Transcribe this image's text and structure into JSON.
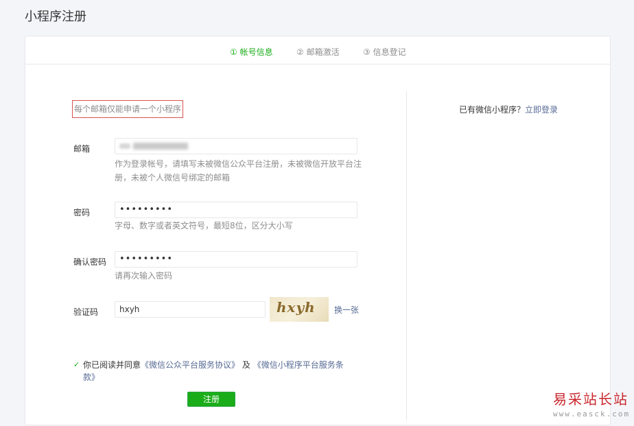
{
  "page": {
    "title": "小程序注册"
  },
  "steps": [
    {
      "label": "① 帐号信息",
      "active": true
    },
    {
      "label": "② 邮箱激活",
      "active": false
    },
    {
      "label": "③ 信息登记",
      "active": false
    }
  ],
  "form": {
    "notice": "每个邮箱仅能申请一个小程序",
    "email": {
      "label": "邮箱",
      "hint": "作为登录帐号，请填写未被微信公众平台注册，未被微信开放平台注册，未被个人微信号绑定的邮箱"
    },
    "password": {
      "label": "密码",
      "value": "•••••••••",
      "hint": "字母、数字或者英文符号，最短8位，区分大小写"
    },
    "confirm_password": {
      "label": "确认密码",
      "value": "•••••••••",
      "hint": "请再次输入密码"
    },
    "captcha": {
      "label": "验证码",
      "value": "hxyh",
      "image_text": "hxyh",
      "swap_label": "换一张"
    },
    "agreement": {
      "prefix": "你已阅读并同意",
      "link1": "《微信公众平台服务协议》",
      "and": "及",
      "link2": "《微信小程序平台服务条款》"
    },
    "submit_label": "注册"
  },
  "side": {
    "question": "已有微信小程序？",
    "login_link": "立即登录"
  },
  "watermark": {
    "main": "易采站长站",
    "url": "www.easck.com"
  },
  "colors": {
    "accent": "#1aad19",
    "link": "#576b95",
    "notice_border": "#d9534f",
    "muted": "#8d8d8d"
  }
}
